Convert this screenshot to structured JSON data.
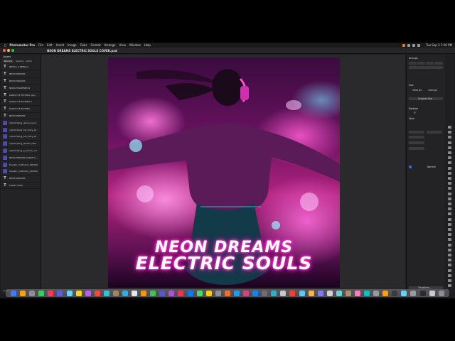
{
  "menubar": {
    "app_name": "Photomator Pro",
    "items": [
      "File",
      "Edit",
      "Insert",
      "Image",
      "Tools",
      "Format",
      "Arrange",
      "View",
      "Window",
      "Help"
    ],
    "clock": "Tue Sep 3 1:16 PM"
  },
  "window": {
    "document_title": "NEON DREAMS ELECTRIC SOULS COVER.pxd"
  },
  "layers_panel": {
    "title": "Layers",
    "blend_mode": "Normal",
    "opacity_label": "Opacity",
    "opacity_value": "100%",
    "layers": [
      {
        "name": "NEON | A NEBULA",
        "kind": "text"
      },
      {
        "name": "NEON DREAMS",
        "kind": "text"
      },
      {
        "name": "NEON DREAMS",
        "kind": "text"
      },
      {
        "name": "NEON HEARTBEATS",
        "kind": "text"
      },
      {
        "name": "DANCE OF ECHOES copy",
        "kind": "text"
      },
      {
        "name": "DANCE OF ECHOES 2",
        "kind": "text"
      },
      {
        "name": "DANCE OF ECHOES",
        "kind": "text"
      },
      {
        "name": "NEON DREAMS",
        "kind": "text"
      },
      {
        "name": "cybertriping_dance_neon_",
        "kind": "image"
      },
      {
        "name": "cybertriping_full_body_sh",
        "kind": "image"
      },
      {
        "name": "cybertriping_full_body_sh",
        "kind": "image"
      },
      {
        "name": "cybertriping_female_teen",
        "kind": "image"
      },
      {
        "name": "cybertriping_a_person_rol",
        "kind": "image"
      },
      {
        "name": "NEON DREAMS DANCE S...",
        "kind": "image"
      },
      {
        "name": "frowalk_cinthamor_6f0340",
        "kind": "image"
      },
      {
        "name": "frowalk_cinthamor_6f0340",
        "kind": "image"
      },
      {
        "name": "NEON DREAMS",
        "kind": "text"
      },
      {
        "name": "FRONT LAYR",
        "kind": "text"
      }
    ],
    "footer": "Layers"
  },
  "artwork": {
    "headline_line1": "NEON DREAMS",
    "headline_line2": "ELECTRIC SOULS"
  },
  "properties_panel": {
    "arrange_label": "Arrange",
    "size_label": "Size",
    "size_w": "3102 px",
    "size_h": "3102 px",
    "original_size_button": "Original Size",
    "rotation_label": "Rotation",
    "rotation_value": "0°",
    "style_label": "Style",
    "blend_label": "Normal",
    "transform_button": "Transform..."
  },
  "colors": {
    "accent_blue": "#2e6bd6",
    "neon_pink": "#ff1fc8"
  }
}
